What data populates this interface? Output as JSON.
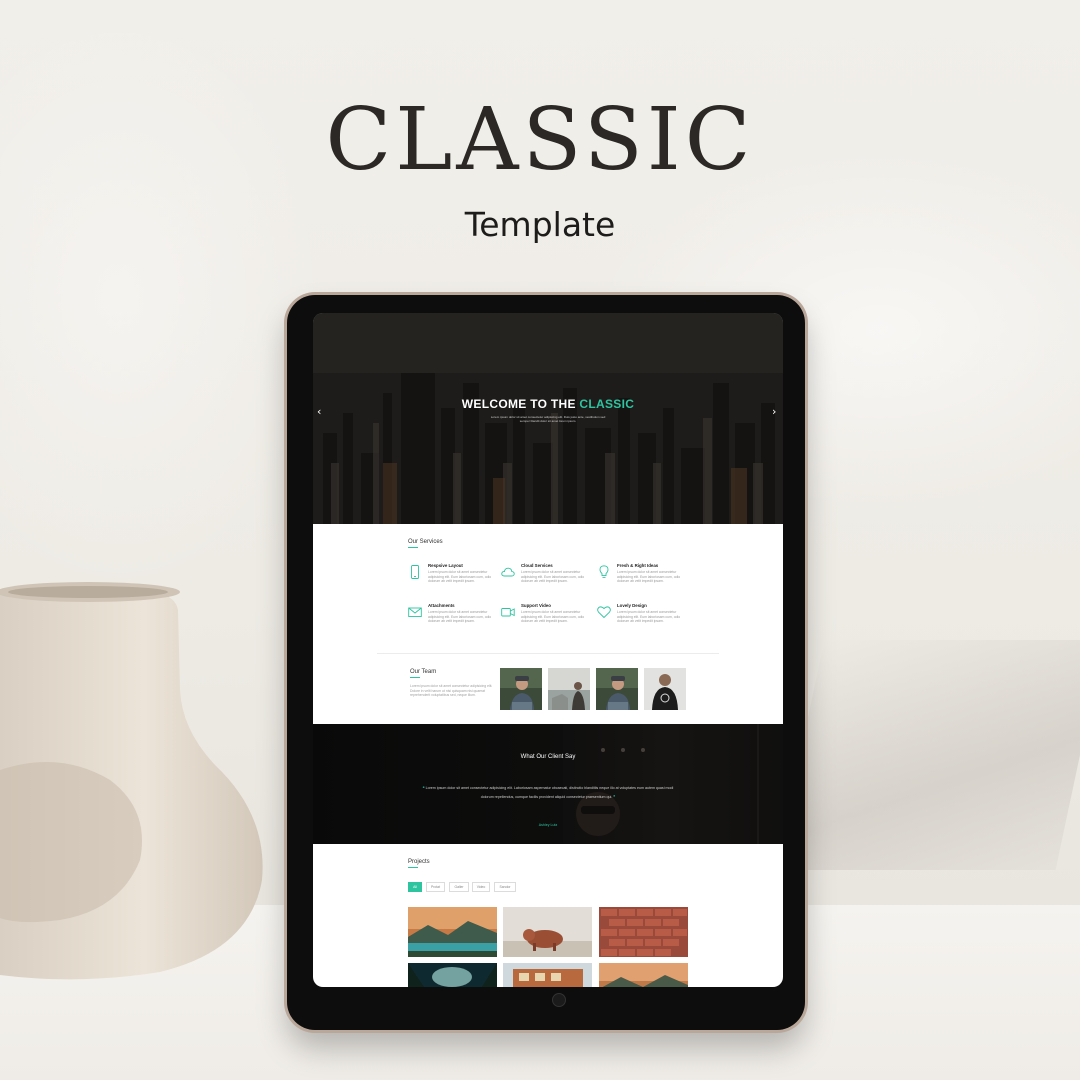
{
  "headline": "CLASSIC",
  "subline": "Template",
  "site": {
    "hero": {
      "title_prefix": "WELCOME TO THE",
      "title_accent": "CLASSIC",
      "subtitle": "Lorem ipsum dolor sit amet consectetur adipiscing elit. Duis justo ante, vestibulum sed semper blandit dolor sit amet lorem ipsum.",
      "prev_arrow": "‹",
      "next_arrow": "›"
    },
    "services": {
      "heading": "Our Services",
      "items": [
        {
          "title": "Respsive Layout",
          "icon": "mobile-icon",
          "text": "Lorem ipsum dolor sit amet consectetur adipisicing elit. Eum laboriosam cum, odio dolorum ab velit impedit ipsam."
        },
        {
          "title": "Cloud Services",
          "icon": "cloud-icon",
          "text": "Lorem ipsum dolor sit amet consectetur adipisicing elit. Eum laboriosam cum, odio dolorum ab velit impedit ipsam."
        },
        {
          "title": "Fresh & Right Ideas",
          "icon": "lightbulb-icon",
          "text": "Lorem ipsum dolor sit amet consectetur adipisicing elit. Eum laboriosam cum, odio dolorum ab velit impedit ipsam."
        },
        {
          "title": "Attachments",
          "icon": "envelope-icon",
          "text": "Lorem ipsum dolor sit amet consectetur adipisicing elit. Eum laboriosam cum, odio dolorum ab velit impedit ipsam."
        },
        {
          "title": "Support Video",
          "icon": "video-icon",
          "text": "Lorem ipsum dolor sit amet consectetur adipisicing elit. Eum laboriosam cum, odio dolorum ab velit impedit ipsam."
        },
        {
          "title": "Lovely Design",
          "icon": "heart-icon",
          "text": "Lorem ipsum dolor sit amet consectetur adipisicing elit. Eum laboriosam cum, odio dolorum ab velit impedit ipsam."
        }
      ]
    },
    "team": {
      "heading": "Our Team",
      "text": "Lorem ipsum dolor sit amet consectetur adipisicing elit. Dolore in velit harum ut nisi quisquam nisi quaerat reprehenderit voluptatibus sed, neque illum."
    },
    "testimonial": {
      "heading": "What Our Client Say",
      "quote": "Lorem ipsum dolor sit amet consectetur adipisicing elit. Laboriosam aspernatur obcaecati, distinctio blanditiis neque illo at voluptates eum autem quasi modi dolorum repellendus, cumque facilis provident aliquid consectetur praesentium qui.",
      "quote_open": "❝",
      "quote_close": "❞",
      "author": "Ashley Lutz"
    },
    "projects": {
      "heading": "Projects",
      "filters": [
        "All",
        "Protat",
        "Galler",
        "Video",
        "Sandor"
      ]
    }
  },
  "colors": {
    "accent": "#2ec4a0",
    "tablet_frame": "#0e0d0d",
    "headline": "#2b2825"
  }
}
